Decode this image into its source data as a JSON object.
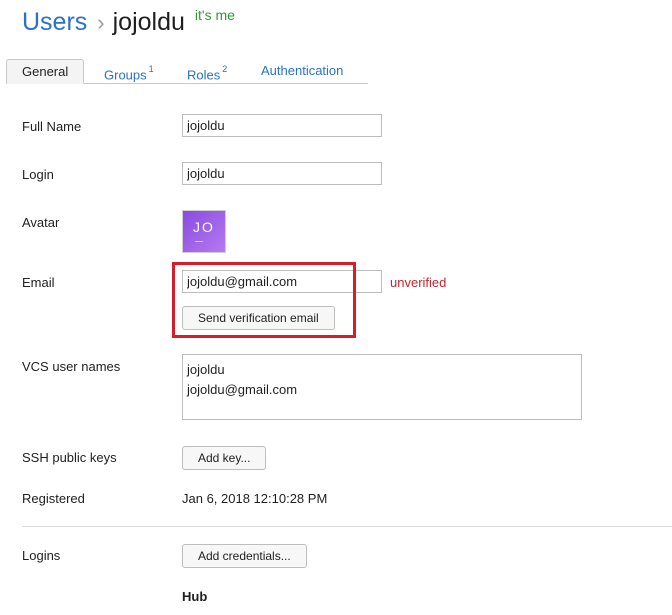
{
  "header": {
    "section_link": "Users",
    "separator": "›",
    "username": "jojoldu",
    "self_badge": "it's me"
  },
  "tabs": [
    {
      "label": "General",
      "badge": ""
    },
    {
      "label": "Groups",
      "badge": "1"
    },
    {
      "label": "Roles",
      "badge": "2"
    },
    {
      "label": "Authentication",
      "badge": ""
    }
  ],
  "form": {
    "full_name": {
      "label": "Full Name",
      "value": "jojoldu"
    },
    "login": {
      "label": "Login",
      "value": "jojoldu"
    },
    "avatar": {
      "label": "Avatar",
      "initials": "JO"
    },
    "email": {
      "label": "Email",
      "value": "jojoldu@gmail.com",
      "status": "unverified",
      "verify_button": "Send verification email"
    },
    "vcs": {
      "label": "VCS user names",
      "lines": [
        "jojoldu",
        "jojoldu@gmail.com"
      ]
    },
    "ssh": {
      "label": "SSH public keys",
      "button": "Add key..."
    },
    "registered": {
      "label": "Registered",
      "value": "Jan 6, 2018 12:10:28 PM"
    },
    "logins": {
      "label": "Logins",
      "button": "Add credentials...",
      "provider": "Hub"
    }
  },
  "colors": {
    "link": "#2a72c8",
    "self_badge": "#2e9a3a",
    "unverified": "#c4262e",
    "highlight": "#d71c2a",
    "avatar_start": "#8a4be0",
    "avatar_end": "#b57af0"
  }
}
